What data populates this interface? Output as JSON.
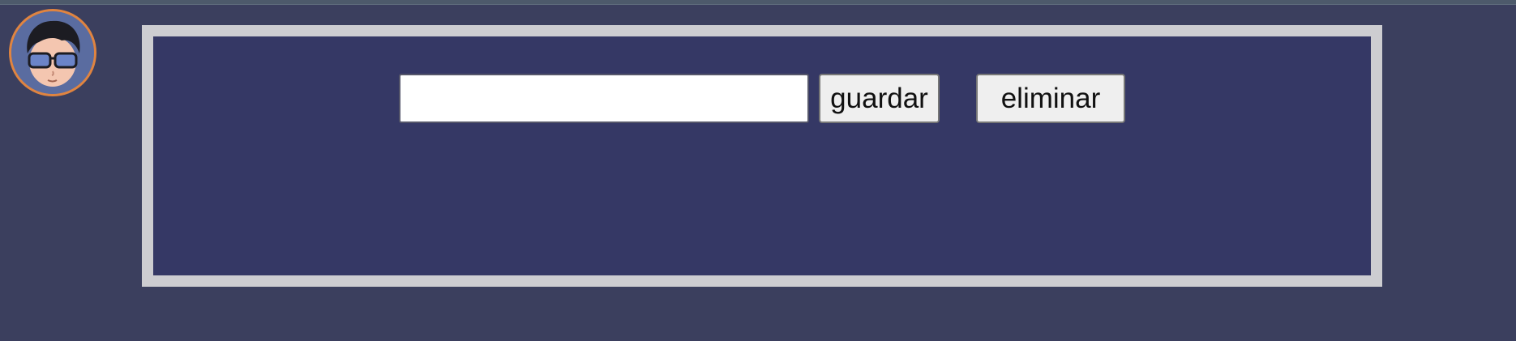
{
  "form": {
    "input_value": "",
    "save_label": "guardar",
    "delete_label": "eliminar"
  },
  "avatar": {
    "icon": "cartoon-avatar-with-sunglasses"
  },
  "colors": {
    "page_background": "#3b3f5e",
    "panel_background": "#353865",
    "panel_border": "#cdcdd1",
    "avatar_ring": "#e08440"
  }
}
